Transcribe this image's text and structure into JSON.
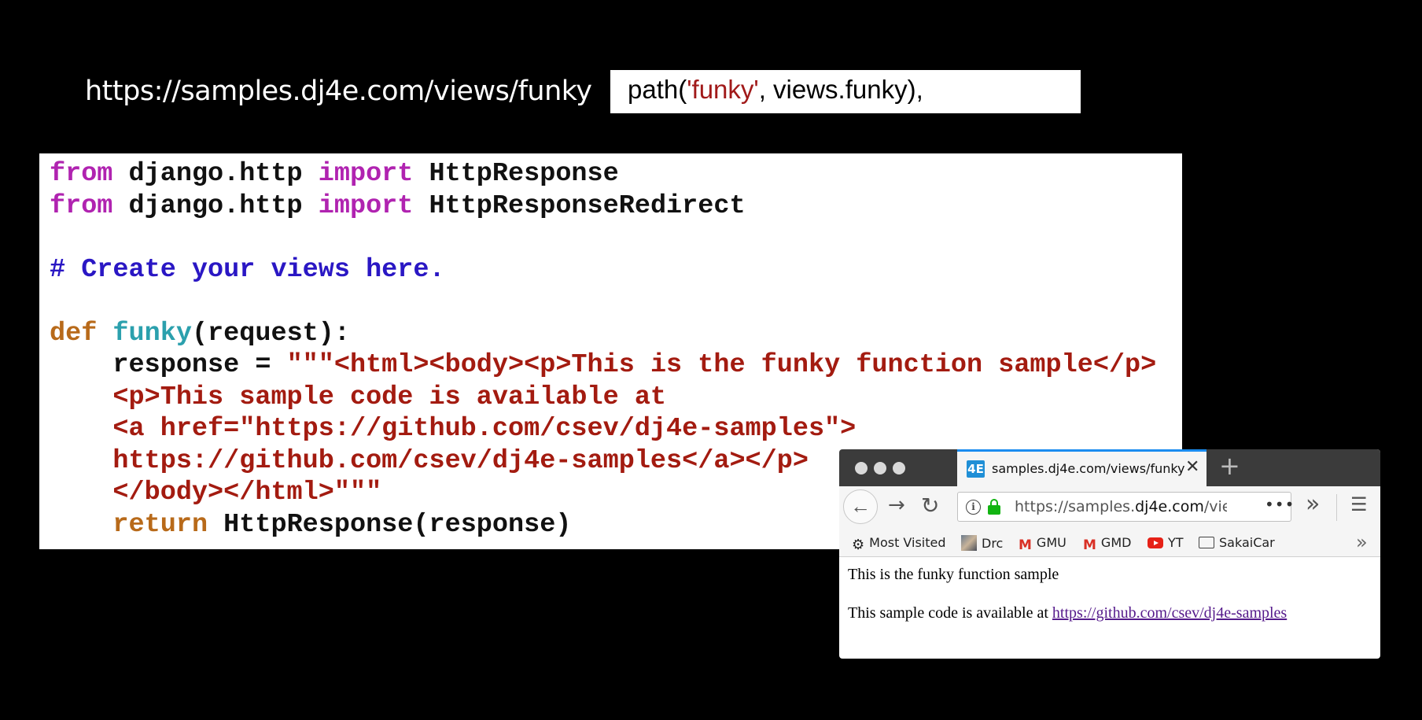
{
  "slide": {
    "url": "https://samples.dj4e.com/views/funky",
    "path_prefix": "path(",
    "path_string": "'funky'",
    "path_suffix": ", views.funky),"
  },
  "code": {
    "line1": {
      "kw1": "from",
      "mod": " django.http ",
      "kw2": "import",
      "name": " HttpResponse"
    },
    "line2": {
      "kw1": "from",
      "mod": " django.http ",
      "kw2": "import",
      "name": " HttpResponseRedirect"
    },
    "comment": "# Create your views here.",
    "def_kw": "def",
    "func_name": "funky",
    "func_args": "(request):",
    "resp_assign": "    response = ",
    "str1": "\"\"\"<html><body><p>This is the funky function sample</p>",
    "str2": "    <p>This sample code is available at",
    "str3": "    <a href=\"https://github.com/csev/dj4e-samples\">",
    "str4": "    https://github.com/csev/dj4e-samples</a></p>",
    "str5": "    </body></html>\"\"\"",
    "ret_indent": "    ",
    "ret_kw": "return",
    "ret_rest": " HttpResponse(response)"
  },
  "browser": {
    "favicon_text": "4E",
    "tab_title": "samples.dj4e.com/views/funky",
    "tab_close": "✕",
    "new_tab": "+",
    "back": "←",
    "forward": "→",
    "reload": "↻",
    "info": "i",
    "url_scheme": "https://samples.",
    "url_domain": "dj4e.com",
    "url_rest": "/vie",
    "page_actions": "•••",
    "overflow": "»",
    "menu": "☰",
    "bookmarks": {
      "most_visited": "Most Visited",
      "drc": "Drc",
      "gmu": "GMU",
      "gmd": "GMD",
      "yt": "YT",
      "sakai": "SakaiCar",
      "gmail_glyph": "M",
      "gear": "⚙",
      "more": "»"
    },
    "content": {
      "p1": "This is the funky function sample",
      "p2_text": "This sample code is available at ",
      "p2_link": "https://github.com/csev/dj4e-samples"
    }
  }
}
